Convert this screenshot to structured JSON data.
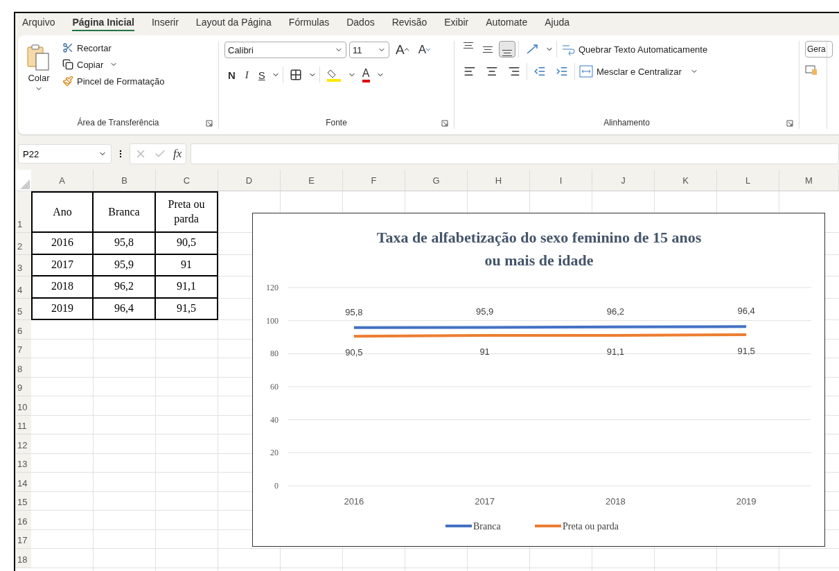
{
  "menu_tabs": [
    {
      "label": "Arquivo",
      "selected": false
    },
    {
      "label": "Página Inicial",
      "selected": true
    },
    {
      "label": "Inserir",
      "selected": false
    },
    {
      "label": "Layout da Página",
      "selected": false
    },
    {
      "label": "Fórmulas",
      "selected": false
    },
    {
      "label": "Dados",
      "selected": false
    },
    {
      "label": "Revisão",
      "selected": false
    },
    {
      "label": "Exibir",
      "selected": false
    },
    {
      "label": "Automate",
      "selected": false
    },
    {
      "label": "Ajuda",
      "selected": false
    }
  ],
  "ribbon": {
    "clipboard": {
      "paste": "Colar",
      "cut": "Recortar",
      "copy": "Copiar",
      "format_painter": "Pincel de Formatação",
      "label": "Área de Transferência"
    },
    "font": {
      "font_name": "Calibri",
      "font_size": "11",
      "grow": "A",
      "shrink": "A",
      "bold": "N",
      "italic": "I",
      "underline": "S",
      "font_color": "A",
      "label": "Fonte"
    },
    "alignment": {
      "vertical": [
        {
          "selected": false
        },
        {
          "selected": false
        },
        {
          "selected": true
        }
      ],
      "wrap_text": "Quebrar Texto Automaticamente",
      "merge": "Mesclar e Centralizar",
      "label": "Alinhamento"
    },
    "number": {
      "format": "Gera"
    }
  },
  "formula_bar": {
    "name_box": "P22",
    "function_label": "fx"
  },
  "sheet": {
    "columns": [
      "A",
      "B",
      "C",
      "D",
      "E",
      "F",
      "G",
      "H",
      "I",
      "J",
      "K",
      "L",
      "M"
    ],
    "rows": [
      "1",
      "2",
      "3",
      "4",
      "5",
      "6",
      "7",
      "8",
      "9",
      "10",
      "11",
      "12",
      "13",
      "14",
      "15",
      "16",
      "17",
      "18"
    ],
    "table": [
      [
        "Ano",
        "Branca",
        "Preta ou parda"
      ],
      [
        "2016",
        "95,8",
        "90,5"
      ],
      [
        "2017",
        "95,9",
        "91"
      ],
      [
        "2018",
        "96,2",
        "91,1"
      ],
      [
        "2019",
        "96,4",
        "91,5"
      ]
    ]
  },
  "chart": {
    "chart_data": {
      "type": "line",
      "title": "Taxa de alfabetização do sexo feminino de 15 anos ou mais de idade",
      "categories": [
        "2016",
        "2017",
        "2018",
        "2019"
      ],
      "series": [
        {
          "name": "Branca",
          "color": "#4472c4",
          "values": [
            95.8,
            95.9,
            96.2,
            96.4
          ]
        },
        {
          "name": "Preta ou parda",
          "color": "#ed7d31",
          "values": [
            90.5,
            91,
            91.1,
            91.5
          ]
        }
      ],
      "ylim": [
        0,
        120
      ],
      "yticks": [
        0,
        20,
        40,
        60,
        80,
        100,
        120
      ],
      "grid": true,
      "legend": "bottom",
      "value_labels": [
        [
          "95,8",
          "95,9",
          "96,2",
          "96,4"
        ],
        [
          "90,5",
          "91",
          "91,1",
          "91,5"
        ]
      ]
    }
  }
}
